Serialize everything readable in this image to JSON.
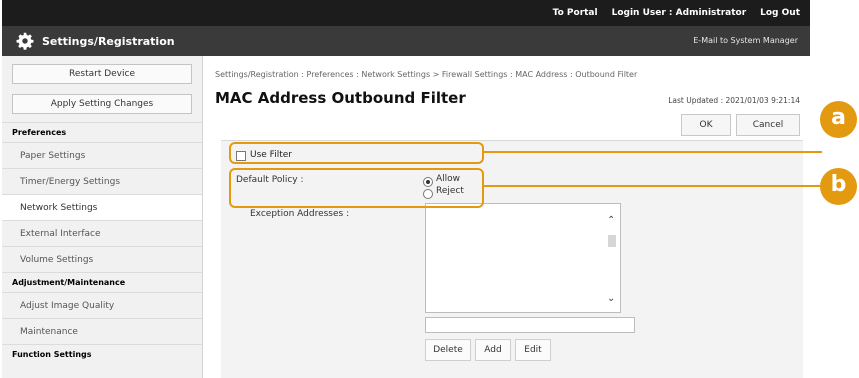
{
  "header": {
    "to_portal": "To Portal",
    "login_user": "Login User : Administrator",
    "log_out": "Log Out",
    "app_title": "Settings/Registration",
    "email_link": "E-Mail to System Manager"
  },
  "sidebar": {
    "restart_button": "Restart Device",
    "apply_button": "Apply Setting Changes",
    "sections": [
      {
        "title": "Preferences",
        "items": [
          "Paper Settings",
          "Timer/Energy Settings",
          "Network Settings",
          "External Interface",
          "Volume Settings"
        ]
      },
      {
        "title": "Adjustment/Maintenance",
        "items": [
          "Adjust Image Quality",
          "Maintenance"
        ]
      },
      {
        "title": "Function Settings",
        "items": []
      }
    ],
    "active_item": "Network Settings"
  },
  "main": {
    "breadcrumb": "Settings/Registration : Preferences : Network Settings > Firewall Settings : MAC Address : Outbound Filter",
    "title": "MAC Address Outbound Filter",
    "last_updated": "Last Updated : 2021/01/03 9:21:14",
    "ok": "OK",
    "cancel": "Cancel",
    "use_filter": "Use Filter",
    "use_filter_checked": false,
    "default_policy_label": "Default Policy :",
    "policy_options": [
      "Allow",
      "Reject"
    ],
    "policy_selected": "Allow",
    "exception_label": "Exception Addresses :",
    "address_input_value": "",
    "delete": "Delete",
    "add": "Add",
    "edit": "Edit"
  },
  "callouts": {
    "a": "a",
    "b": "b"
  },
  "colors": {
    "accent": "#e39a10",
    "topbar": "#1c1c1c",
    "titlebar": "#3a3a3a"
  }
}
